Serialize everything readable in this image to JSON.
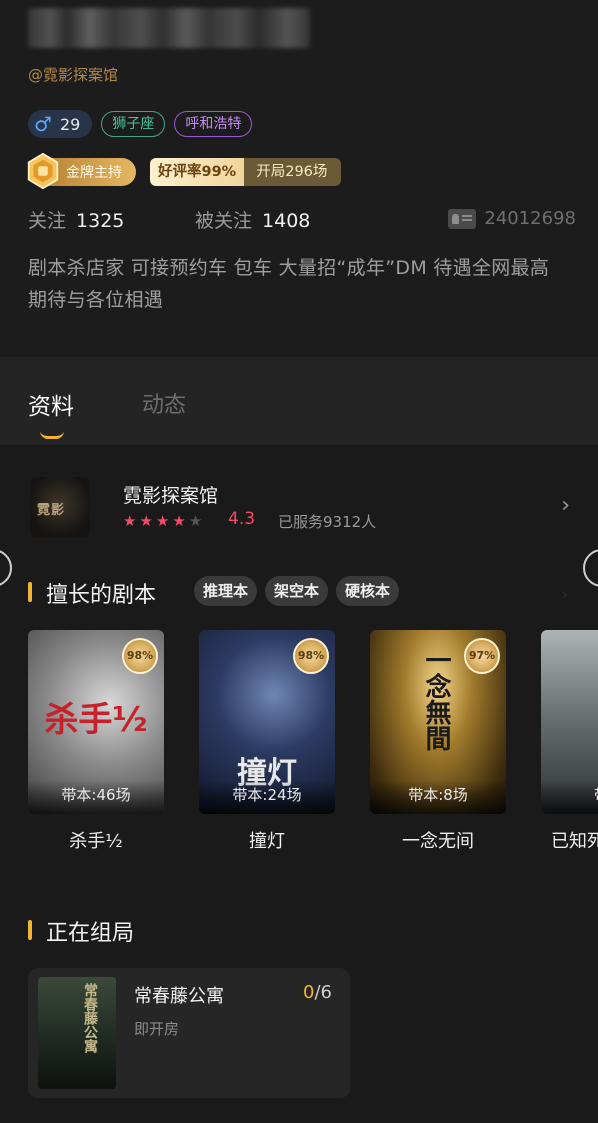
{
  "profile": {
    "handle": "@霓影探案馆",
    "gender_icon": "male-icon",
    "age": "29",
    "zodiac": "狮子座",
    "city": "呼和浩特",
    "gold_badge": "金牌主持",
    "good_rate": "好评率99%",
    "sessions": "开局296场",
    "following_label": "关注",
    "following": "1325",
    "followers_label": "被关注",
    "followers": "1408",
    "user_id": "24012698",
    "bio": "剧本杀店家 可接预约车 包车 大量招“成年”DM 待遇全网最高 期待与各位相遇"
  },
  "tabs": [
    {
      "label": "资料",
      "active": true
    },
    {
      "label": "动态",
      "active": false
    }
  ],
  "store": {
    "name": "霓影探案馆",
    "logo_text": "霓影",
    "rating": 4.3,
    "rating_text": "4.3",
    "stars": [
      "★",
      "★",
      "★",
      "★",
      "★"
    ],
    "served": "已服务9312人",
    "arrow": "›"
  },
  "scripts_section": {
    "title": "擅长的剧本",
    "genres": [
      "推理本",
      "架空本",
      "硬核本"
    ],
    "items": [
      {
        "name": "杀手½",
        "poster_text": "杀手½",
        "rate": "98%",
        "times": "带本:46场"
      },
      {
        "name": "撞灯",
        "poster_text": "撞灯",
        "rate": "98%",
        "times": "带本:24场"
      },
      {
        "name": "一念无间",
        "poster_text": "一念無間",
        "rate": "97%",
        "times": "带本:8场"
      },
      {
        "name": "已知死",
        "poster_text": "",
        "rate": "",
        "times": "带本"
      }
    ]
  },
  "forming_section": {
    "title": "正在组局",
    "room": {
      "name": "常春藤公寓",
      "poster_text": "常春藤公寓",
      "count_current": "0",
      "count_total": "/6",
      "status": "即开房"
    }
  },
  "colors": {
    "accent_gold": "#f2b531",
    "rating_red": "#f44a65",
    "zodiac_green": "#46c59a",
    "city_purple": "#c48af2",
    "male_blue": "#5aa7ff"
  }
}
